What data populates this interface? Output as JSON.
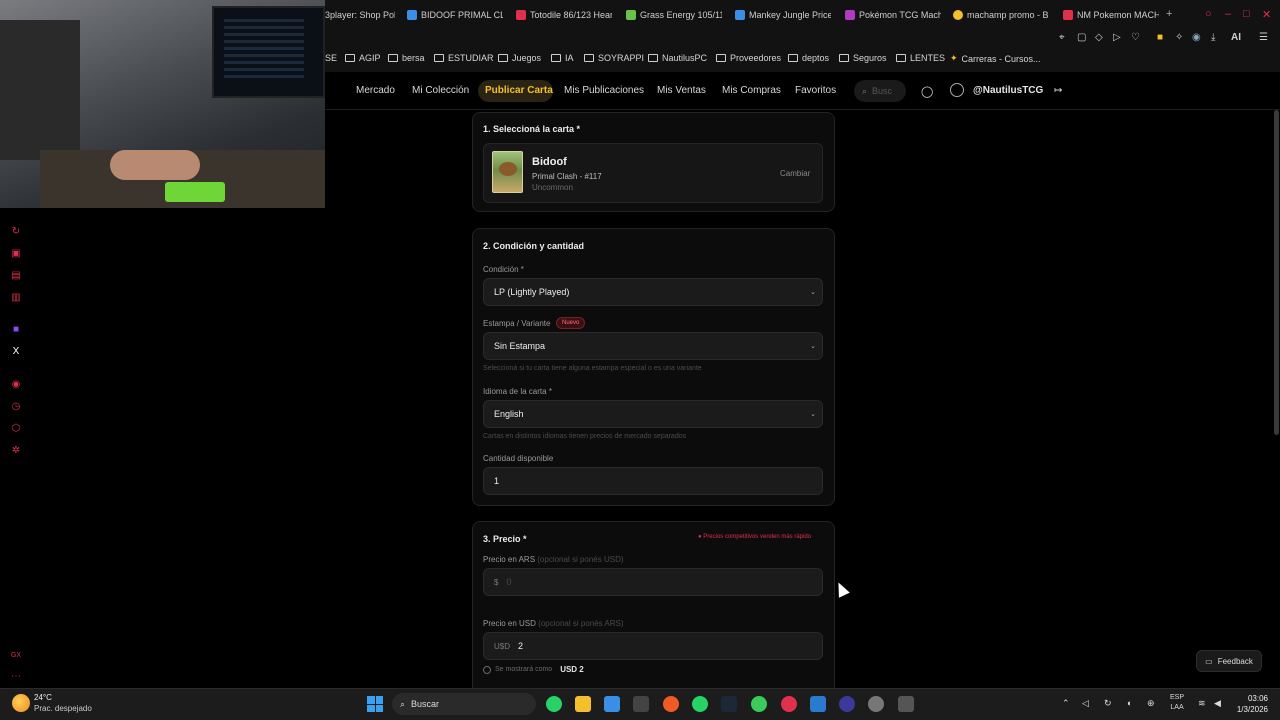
{
  "browser": {
    "tabs": [
      {
        "label": "3player: Shop Pok",
        "color": "#7a7a7a"
      },
      {
        "label": "BIDOOF PRIMAL CLA",
        "color": "#3a8ee6"
      },
      {
        "label": "Totodile 86/123 Hear",
        "color": "#e0304b"
      },
      {
        "label": "Grass Energy 105/114",
        "color": "#6ac24a"
      },
      {
        "label": "Mankey Jungle Price",
        "color": "#3a8ee6"
      },
      {
        "label": "Pokémon TCG Mach",
        "color": "#b03ac0"
      },
      {
        "label": "machamp promo - B",
        "color": "#f3c02b"
      },
      {
        "label": "NM Pokemon MACHA",
        "color": "#e0304b"
      }
    ],
    "toolbar_ai": "AI"
  },
  "bookmarks": [
    {
      "label": "SE"
    },
    {
      "label": "AGIP"
    },
    {
      "label": "bersa"
    },
    {
      "label": "ESTUDIAR"
    },
    {
      "label": "Juegos"
    },
    {
      "label": "IA"
    },
    {
      "label": "SOYRAPPI"
    },
    {
      "label": "NautilusPC"
    },
    {
      "label": "Proveedores"
    },
    {
      "label": "deptos"
    },
    {
      "label": "Seguros"
    },
    {
      "label": "LENTES"
    },
    {
      "label": "Carreras - Cursos..."
    }
  ],
  "nav": {
    "items": [
      "Mercado",
      "Mi Colección",
      "Publicar Carta",
      "Mis Publicaciones",
      "Mis Ventas",
      "Mis Compras",
      "Favoritos"
    ],
    "active": "Publicar Carta",
    "search_placeholder": "Busc",
    "username": "@NautilusTCG"
  },
  "step1": {
    "title": "1. Seleccioná la carta *",
    "card_name": "Bidoof",
    "card_set": "Primal Clash - #117",
    "card_rarity": "Uncommon",
    "change_label": "Cambiar"
  },
  "step2": {
    "title": "2. Condición y cantidad",
    "condition_label": "Condición *",
    "condition_value": "LP (Lightly Played)",
    "variant_label": "Estampa / Variante",
    "variant_badge": "Nuevo",
    "variant_value": "Sin Estampa",
    "variant_help": "Seleccioná si tu carta tiene alguna estampa especial o es una variante",
    "language_label": "Idioma de la carta *",
    "language_value": "English",
    "language_help": "Cartas en distintos idiomas tienen precios de mercado separados",
    "quantity_label": "Cantidad disponible",
    "quantity_value": "1"
  },
  "step3": {
    "title": "3. Precio *",
    "hint": "● Precios competitivos venden más rápido",
    "ars_label": "Precio en ARS",
    "ars_optional": "(opcional si ponés USD)",
    "ars_prefix": "$",
    "ars_placeholder": "0",
    "usd_label": "Precio en USD",
    "usd_optional": "(opcional si ponés ARS)",
    "usd_prefix": "U$D",
    "usd_value": "2",
    "preview_text": "Se mostrará como",
    "preview_value": "USD 2"
  },
  "feedback_label": "Feedback",
  "taskbar": {
    "temp": "24°C",
    "weather": "Prac. despejado",
    "search": "Buscar",
    "lang_top": "ESP",
    "lang_bottom": "LAA",
    "time": "03:06",
    "date": "1/3/2026"
  },
  "colors": {
    "accent": "#f3c02b",
    "danger": "#e0304b",
    "background": "#000000"
  }
}
